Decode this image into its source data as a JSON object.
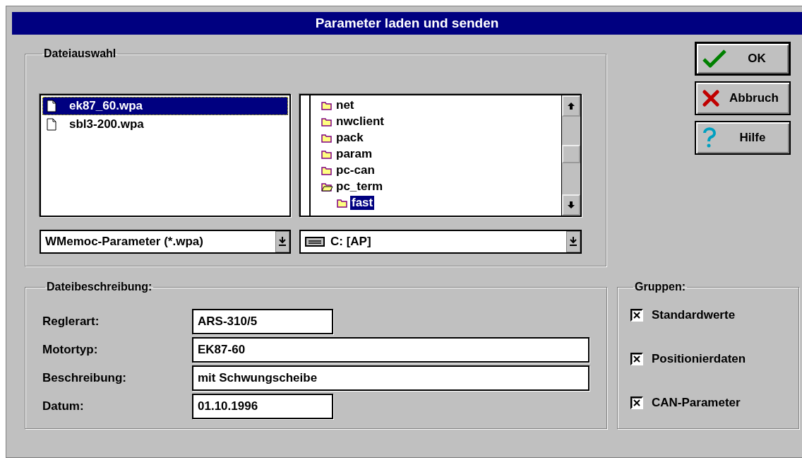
{
  "window": {
    "title": "Parameter laden und senden"
  },
  "file_selection": {
    "title": "Dateiauswahl",
    "files": [
      {
        "name": "ek87_60.wpa",
        "selected": true
      },
      {
        "name": "sbl3-200.wpa",
        "selected": false
      }
    ],
    "folders": [
      {
        "name": "net",
        "expanded": false,
        "selected": false
      },
      {
        "name": "nwclient",
        "expanded": false,
        "selected": false
      },
      {
        "name": "pack",
        "expanded": false,
        "selected": false
      },
      {
        "name": "param",
        "expanded": false,
        "selected": false
      },
      {
        "name": "pc-can",
        "expanded": false,
        "selected": false
      },
      {
        "name": "pc_term",
        "expanded": true,
        "selected": false,
        "children": [
          {
            "name": "fast",
            "expanded": false,
            "selected": true
          }
        ]
      }
    ],
    "file_type": "WMemoc-Parameter (*.wpa)",
    "drive": "C: [AP]"
  },
  "buttons": [
    {
      "label": "OK",
      "kind": "ok",
      "default": true
    },
    {
      "label": "Abbruch",
      "kind": "cancel",
      "default": false
    },
    {
      "label": "Hilfe",
      "kind": "help",
      "default": false
    }
  ],
  "description": {
    "title": "Dateibeschreibung:",
    "fields": [
      {
        "label": "Reglerart:",
        "value": "ARS-310/5",
        "kind": "short"
      },
      {
        "label": "Motortyp:",
        "value": "EK87-60",
        "kind": "long"
      },
      {
        "label": "Beschreibung:",
        "value": "mit Schwungscheibe",
        "kind": "long"
      },
      {
        "label": "Datum:",
        "value": "01.10.1996",
        "kind": "short"
      }
    ]
  },
  "groups": {
    "title": "Gruppen:",
    "items": [
      {
        "label": "Standardwerte",
        "checked": true
      },
      {
        "label": "Positionierdaten",
        "checked": true
      },
      {
        "label": "CAN-Parameter",
        "checked": true
      }
    ]
  }
}
